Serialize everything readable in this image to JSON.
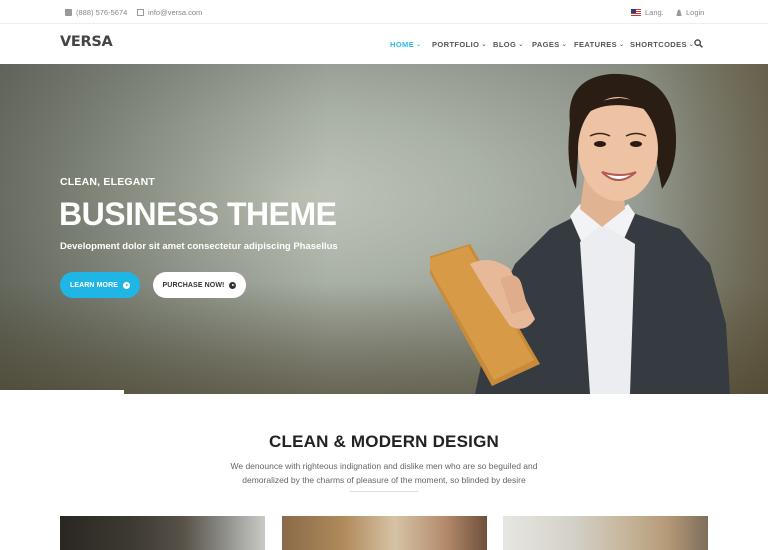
{
  "topbar": {
    "phone": "(888) 576-5674",
    "email": "info@versa.com",
    "lang": "Lang.",
    "login": "Login"
  },
  "nav": {
    "logo": "VERSA",
    "items": [
      {
        "label": "HOME",
        "active": true
      },
      {
        "label": "PORTFOLIO",
        "active": false
      },
      {
        "label": "BLOG",
        "active": false
      },
      {
        "label": "PAGES",
        "active": false
      },
      {
        "label": "FEATURES",
        "active": false
      },
      {
        "label": "SHORTCODES",
        "active": false
      }
    ],
    "accent": "#2cb8e4"
  },
  "hero": {
    "eyebrow": "CLEAN, ELEGANT",
    "title": "BUSINESS THEME",
    "subtitle": "Development dolor sit amet consectetur adipiscing Phasellus",
    "learn_more": "LEARN MORE",
    "purchase": "PURCHASE NOW!",
    "button_color": "#1fb6e5"
  },
  "section": {
    "title": "CLEAN & MODERN DESIGN",
    "text_line1": "We denounce with righteous indignation and dislike men who are so beguiled and",
    "text_line2": "demoralized by the charms of pleasure of the moment, so blinded by desire"
  },
  "icons": {
    "phone": "phone-icon",
    "email": "mail-icon",
    "lang": "us-flag-icon",
    "login": "user-icon",
    "search": "search-icon",
    "chevron": "chevron-down-icon",
    "arrow": "arrow-circle-right-icon"
  }
}
